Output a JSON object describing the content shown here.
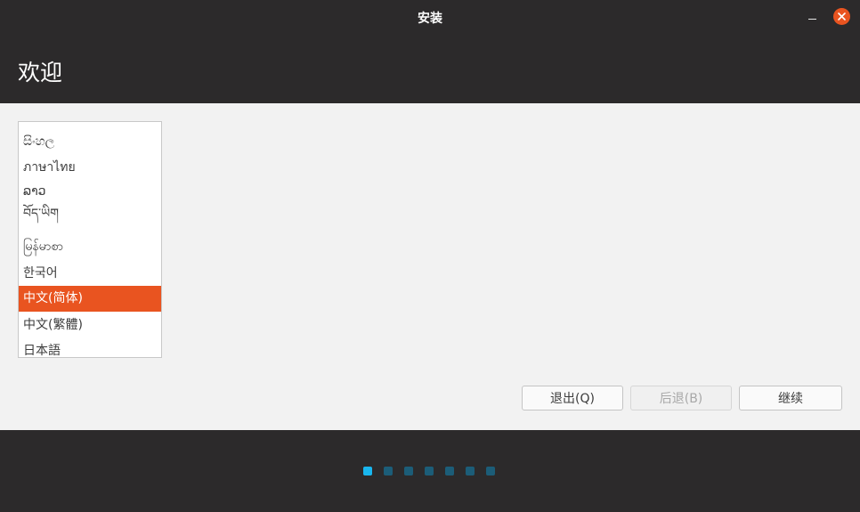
{
  "window": {
    "title": "安装"
  },
  "header": {
    "title": "欢迎"
  },
  "language_list": {
    "items": [
      {
        "label": "සිංහල",
        "selected": false
      },
      {
        "label": "ภาษาไทย",
        "selected": false
      },
      {
        "label": "ລາວ",
        "selected": false
      },
      {
        "label": "བོད་ཡིག",
        "selected": false
      },
      {
        "label": "မြန်မာစာ",
        "selected": false
      },
      {
        "label": "한국어",
        "selected": false
      },
      {
        "label": "中文(简体)",
        "selected": true
      },
      {
        "label": "中文(繁體)",
        "selected": false
      },
      {
        "label": "日本語",
        "selected": false
      }
    ]
  },
  "buttons": {
    "quit_label": "退出(Q)",
    "back_label": "后退(B)",
    "continue_label": "继续"
  },
  "progress": {
    "total_steps": 7,
    "current_step": 1
  },
  "colors": {
    "accent": "#e95420",
    "dark_bg": "#2c2a2b",
    "active_dot": "#19b6ee",
    "inactive_dot": "#1c5d78"
  },
  "icons": {
    "minimize": "minimize-icon",
    "close": "close-icon"
  }
}
